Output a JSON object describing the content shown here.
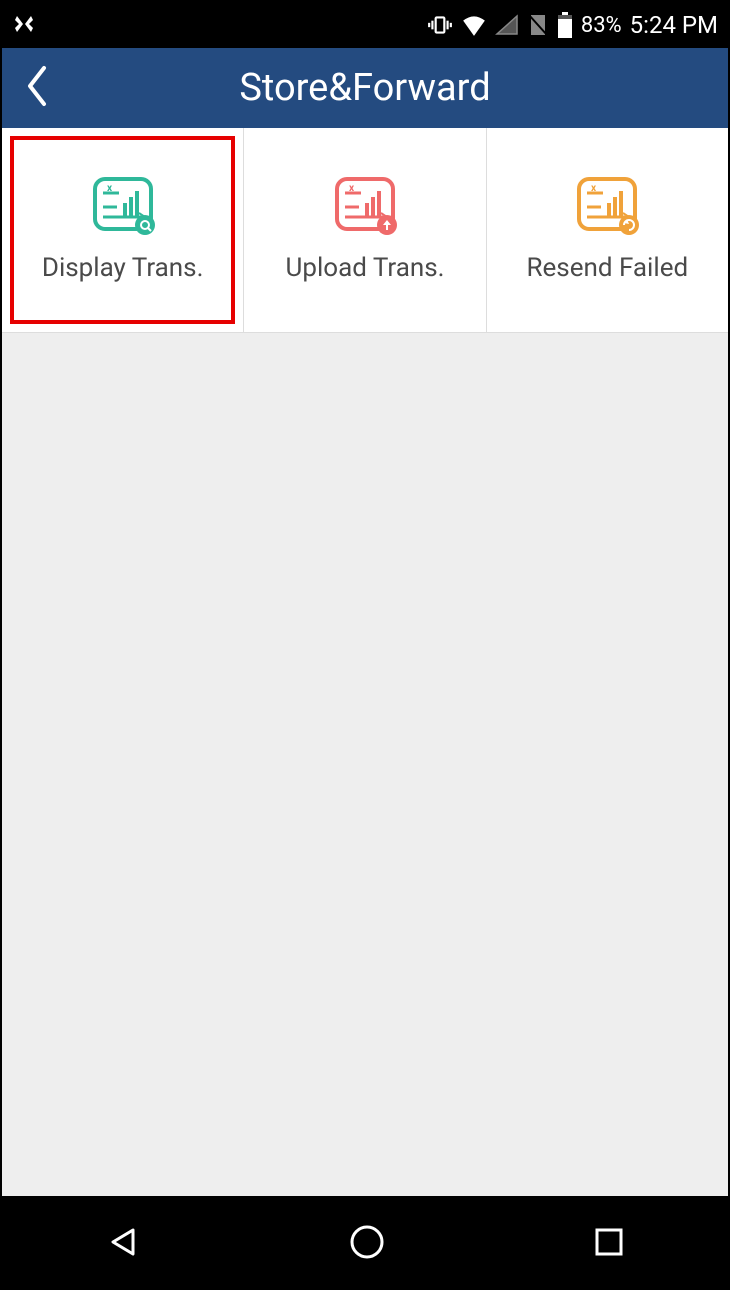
{
  "status_bar": {
    "battery_percent": "83%",
    "time": "5:24 PM"
  },
  "header": {
    "title": "Store&Forward"
  },
  "tiles": [
    {
      "label": "Display Trans.",
      "color": "#2fb89a",
      "badge": "search",
      "selected": true
    },
    {
      "label": "Upload Trans.",
      "color": "#ef6a6a",
      "badge": "upload",
      "selected": false
    },
    {
      "label": "Resend Failed",
      "color": "#f0a23a",
      "badge": "retry",
      "selected": false
    }
  ]
}
